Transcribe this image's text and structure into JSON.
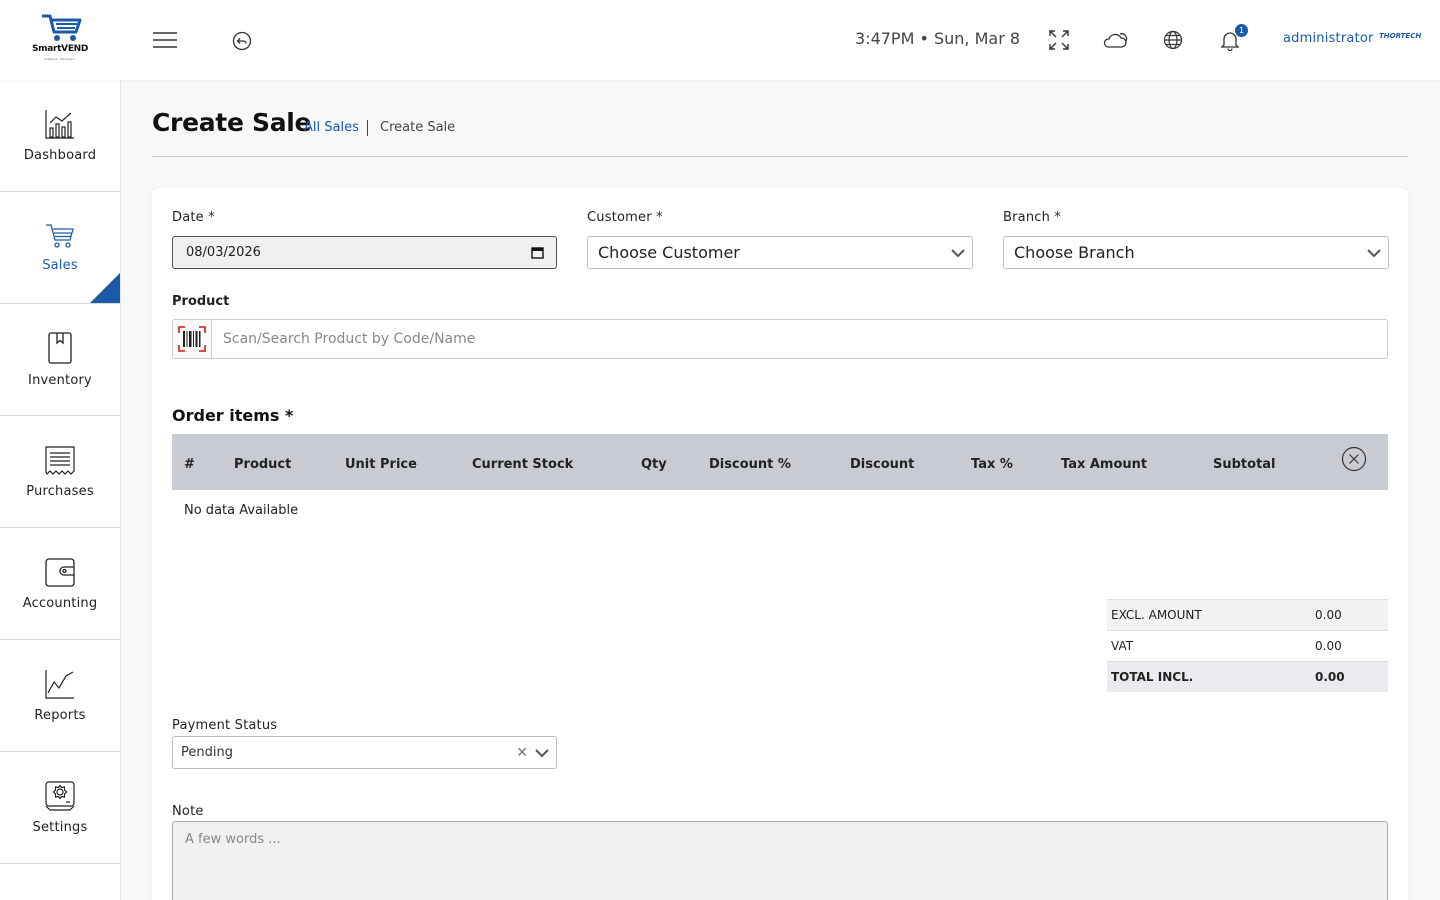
{
  "app": {
    "brand_name": "SmartVEND",
    "brand_tagline": "Software · Hardware"
  },
  "header": {
    "datetime": "3:47PM • Sun, Mar 8",
    "notification_count": "1",
    "user_name": "administrator",
    "company_logo_text": "THORTECH",
    "icons": [
      "menu-icon",
      "back-icon",
      "fullscreen-icon",
      "weather-icon",
      "globe-icon",
      "bell-icon"
    ]
  },
  "sidebar": {
    "items": [
      {
        "label": "Dashboard",
        "icon": "dashboard-chart-icon",
        "active": false
      },
      {
        "label": "Sales",
        "icon": "cart-icon",
        "active": true
      },
      {
        "label": "Inventory",
        "icon": "book-icon",
        "active": false
      },
      {
        "label": "Purchases",
        "icon": "receipt-icon",
        "active": false
      },
      {
        "label": "Accounting",
        "icon": "wallet-icon",
        "active": false
      },
      {
        "label": "Reports",
        "icon": "line-chart-icon",
        "active": false
      },
      {
        "label": "Settings",
        "icon": "gear-icon",
        "active": false
      }
    ]
  },
  "page": {
    "title": "Create Sale",
    "breadcrumb_link": "All Sales",
    "breadcrumb_current": "Create Sale"
  },
  "form": {
    "date_label": "Date *",
    "date_value": "08/03/2026",
    "customer_label": "Customer *",
    "customer_value": "Choose Customer",
    "branch_label": "Branch *",
    "branch_value": "Choose Branch",
    "product_label": "Product",
    "product_placeholder": "Scan/Search Product by Code/Name",
    "order_items_title": "Order items *",
    "order_columns": [
      "#",
      "Product",
      "Unit Price",
      "Current Stock",
      "Qty",
      "Discount %",
      "Discount",
      "Tax %",
      "Tax Amount",
      "Subtotal"
    ],
    "no_data": "No data Available",
    "totals": [
      {
        "label": "EXCL. AMOUNT",
        "value": "0.00"
      },
      {
        "label": "VAT",
        "value": "0.00"
      },
      {
        "label": "TOTAL INCL.",
        "value": "0.00"
      }
    ],
    "payment_status_label": "Payment Status",
    "payment_status_value": "Pending",
    "note_label": "Note",
    "note_placeholder": "A few words ..."
  },
  "colors": {
    "accent": "#1a5aa8",
    "table_header": "#c8ccd2",
    "date_field_bg": "#f0f0f0"
  }
}
